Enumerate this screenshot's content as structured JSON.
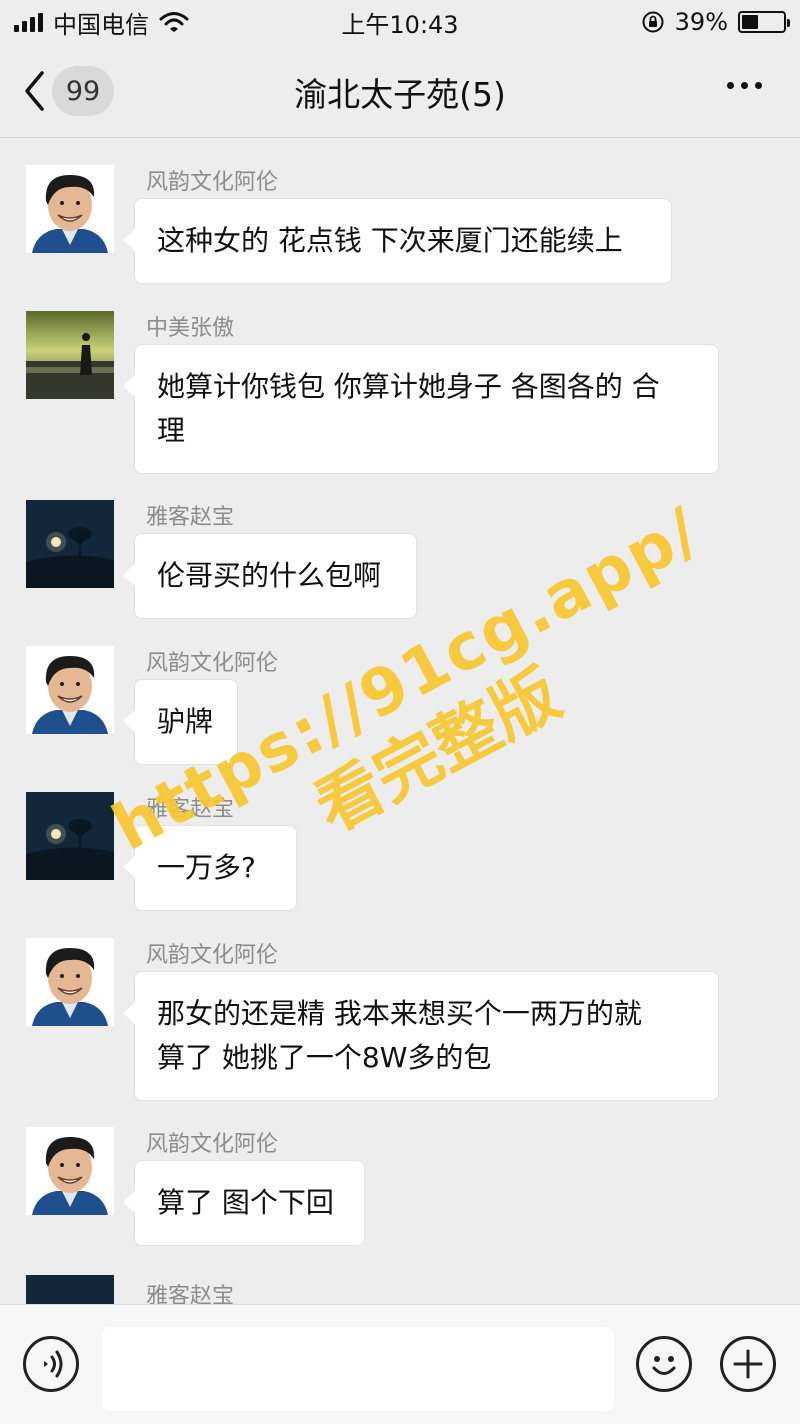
{
  "status_bar": {
    "carrier": "中国电信",
    "time": "上午10:43",
    "battery_percent": "39%",
    "battery_level": 0.39,
    "icons": [
      "signal-icon",
      "wifi-icon",
      "orientation-lock-icon",
      "battery-icon"
    ]
  },
  "nav": {
    "back_icon": "chevron-left-icon",
    "unread_count": "99",
    "title": "渝北太子苑(5)",
    "more_icon": "more-dots-icon"
  },
  "messages": [
    {
      "sender": "风韵文化阿伦",
      "text_lines": [
        "这种女的 花点钱 下次来厦门还能续上"
      ],
      "avatar": "cartoon-man-avatar"
    },
    {
      "sender": "中美张傲",
      "text_lines": [
        "她算计你钱包 你算计她身子 各图各的 合",
        "理"
      ],
      "avatar": "sunset-silhouette-avatar"
    },
    {
      "sender": "雅客赵宝",
      "text_lines": [
        "伦哥买的什么包啊"
      ],
      "avatar": "moon-tree-avatar"
    },
    {
      "sender": "风韵文化阿伦",
      "text_lines": [
        "驴牌"
      ],
      "avatar": "cartoon-man-avatar"
    },
    {
      "sender": "雅客赵宝",
      "text_lines": [
        "一万多?"
      ],
      "avatar": "moon-tree-avatar"
    },
    {
      "sender": "风韵文化阿伦",
      "text_lines": [
        "那女的还是精 我本来想买个一两万的就",
        "算了 她挑了一个8W多的包"
      ],
      "avatar": "cartoon-man-avatar"
    },
    {
      "sender": "风韵文化阿伦",
      "text_lines": [
        "算了 图个下回"
      ],
      "avatar": "cartoon-man-avatar"
    },
    {
      "sender": "雅客赵宝",
      "text_lines": [],
      "avatar": "moon-tree-avatar"
    }
  ],
  "watermark": {
    "line1": "https://91cg.app/",
    "line2": "看完整版",
    "color": "#f7c630"
  },
  "input_bar": {
    "voice_icon": "voice-icon",
    "emoji_icon": "emoji-icon",
    "plus_icon": "plus-icon",
    "input_value": ""
  }
}
